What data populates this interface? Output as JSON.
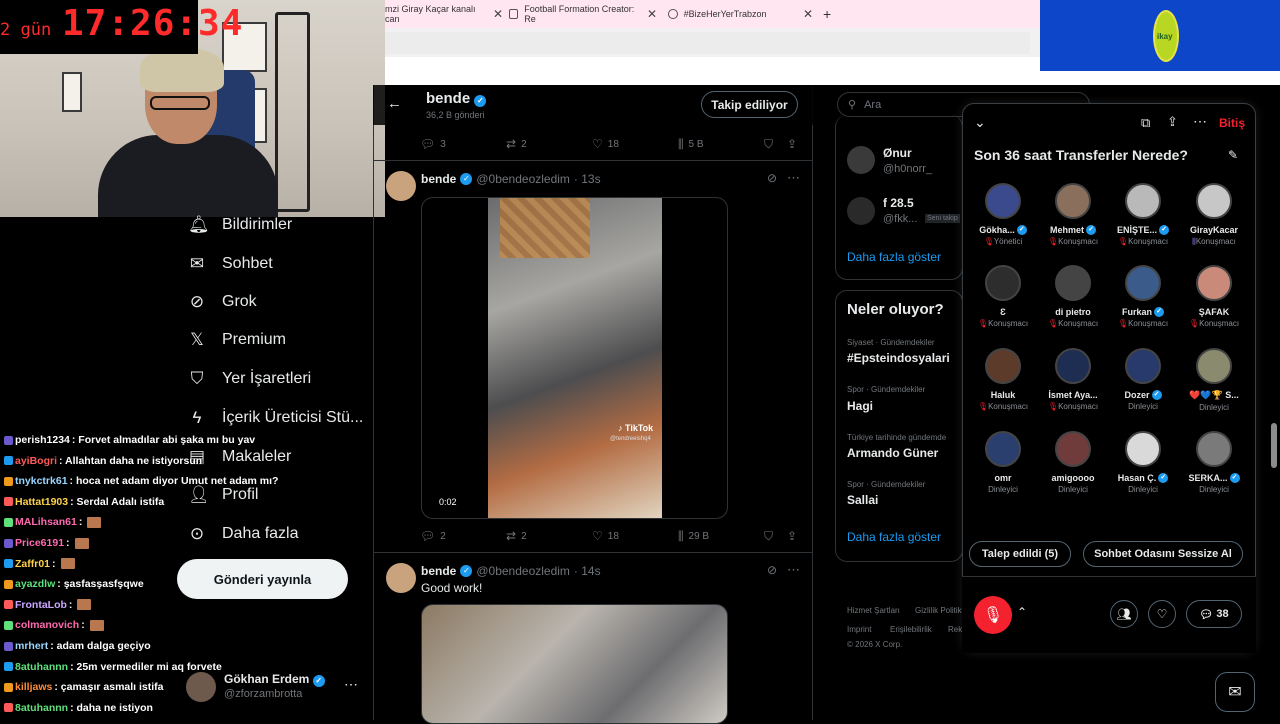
{
  "stream": {
    "timer_days": "2 gün",
    "timer_clock": "17:26:34"
  },
  "browser": {
    "tabs": [
      {
        "label": "mzi Giray Kaçar kanalı can"
      },
      {
        "label": "Football Formation Creator: Re"
      },
      {
        "label": "#BizeHerYerTrabzon"
      }
    ],
    "new_tab": "+",
    "brand_logo_text": "ikay"
  },
  "nav": {
    "items": [
      {
        "label": "Bildirimler",
        "icon": "bell-icon"
      },
      {
        "label": "Sohbet",
        "icon": "mail-icon"
      },
      {
        "label": "Grok",
        "icon": "grok-icon"
      },
      {
        "label": "Premium",
        "icon": "x-logo-icon"
      },
      {
        "label": "Yer İşaretleri",
        "icon": "bookmark-icon"
      },
      {
        "label": "İçerik Üreticisi Stü...",
        "icon": "lightning-icon"
      },
      {
        "label": "Makaleler",
        "icon": "article-icon"
      },
      {
        "label": "Profil",
        "icon": "person-icon"
      },
      {
        "label": "Daha fazla",
        "icon": "more-circle-icon"
      }
    ],
    "post_button": "Gönderi yayınla",
    "profile": {
      "name": "Gökhan Erdem",
      "handle": "@zforzambrotta",
      "more": "⋯"
    }
  },
  "chat": [
    {
      "user": "perish1234",
      "msg": ": Forvet almadılar abi şaka mı bu yav",
      "color": "#ffffff"
    },
    {
      "user": "ayiBogri",
      "msg": ": Allahtan daha ne istiyorsun",
      "color": "#ff5a5a"
    },
    {
      "user": "tnykctrk61",
      "msg": ": hoca net adam diyor Umut net adam mı?",
      "color": "#9ad7ff"
    },
    {
      "user": "Hattat1903",
      "msg": ": Serdal Adalı istifa",
      "color": "#ffd24a"
    },
    {
      "user": "MALihsan61",
      "msg": ":",
      "color": "#ff6ab0",
      "emote": true
    },
    {
      "user": "Price6191",
      "msg": ":",
      "color": "#ff6ab0",
      "emote": true
    },
    {
      "user": "Zaffr01",
      "msg": ":",
      "color": "#ffd24a",
      "emote": true
    },
    {
      "user": "ayazdlw",
      "msg": ": şasfasşasfşqwe",
      "color": "#5ee07a"
    },
    {
      "user": "FrontaLob",
      "msg": ":",
      "color": "#c9a7ff",
      "emote": true
    },
    {
      "user": "colmanovich",
      "msg": ":",
      "color": "#ff6ab0",
      "emote": true
    },
    {
      "user": "mrhert",
      "msg": ": adam dalga geçiyo",
      "color": "#9ad7ff"
    },
    {
      "user": "8atuhannn",
      "msg": ": 25m vermediler mi aq forvete",
      "color": "#5ee07a"
    },
    {
      "user": "killjaws",
      "msg": ": çamaşır asmalı istifa",
      "color": "#ff8c3a"
    },
    {
      "user": "8atuhannn",
      "msg": ": daha ne istiyon",
      "color": "#5ee07a"
    }
  ],
  "timeline": {
    "header_name": "bende",
    "header_count": "36,2 B gönderi",
    "follow_button": "Takip ediliyor",
    "top_actions": {
      "replies": "3",
      "reposts": "2",
      "likes": "18",
      "views": "5 B"
    },
    "tweets": [
      {
        "name": "bende",
        "handle": "@0bendeozledim",
        "time": "· 13s",
        "video_time": "0:02",
        "tiktok": "TikTok",
        "tiktok_user": "@tendreeishq4",
        "replies": "2",
        "reposts": "2",
        "likes": "18",
        "views": "29 B"
      },
      {
        "name": "bende",
        "handle": "@0bendeozledim",
        "time": "· 14s",
        "text": "Good work!"
      }
    ]
  },
  "sidebar": {
    "search_placeholder": "Ara",
    "who_to_follow": [
      {
        "name": "Ønur",
        "handle": "@h0norr_"
      },
      {
        "name": "f 28.5",
        "handle": "@fkk...",
        "badge": "Seni takip"
      }
    ],
    "show_more": "Daha fazla göster",
    "trends_title": "Neler oluyor?",
    "trends": [
      {
        "meta": "Siyaset · Gündemdekiler",
        "name": "#Epsteindosyalari"
      },
      {
        "meta": "Spor · Gündemdekiler",
        "name": "Hagi"
      },
      {
        "meta": "Türkiye tarihinde gündemde",
        "name": "Armando Güner"
      },
      {
        "meta": "Spor · Gündemdekiler",
        "name": "Sallai"
      }
    ],
    "trends_more": "Daha fazla göster",
    "footer": [
      "Hizmet Şartları",
      "Gizlilik Politik",
      "Imprint",
      "Erişilebilirlik",
      "Rek",
      "© 2026 X Corp."
    ]
  },
  "spaces": {
    "end_label": "Bitiş",
    "title": "Son 36 saat Transferler Nerede?",
    "speakers": [
      {
        "name": "Gökha...",
        "role": "Yönetici",
        "verified": true,
        "mic": true
      },
      {
        "name": "Mehmet",
        "role": "Konuşmacı",
        "verified": true,
        "mic": true
      },
      {
        "name": "ENİŞTE...",
        "role": "Konuşmacı",
        "verified": true,
        "mic": true
      },
      {
        "name": "GirayKacar",
        "role": "Konuşmacı",
        "verified": false,
        "mic": false,
        "speaking": true
      },
      {
        "name": "Ɛ",
        "role": "Konuşmacı",
        "verified": false,
        "mic": true
      },
      {
        "name": "di pietro",
        "role": "Konuşmacı",
        "verified": false,
        "mic": true
      },
      {
        "name": "Furkan",
        "role": "Konuşmacı",
        "verified": true,
        "mic": true
      },
      {
        "name": "ŞAFAK",
        "role": "Konuşmacı",
        "verified": false,
        "mic": true
      },
      {
        "name": "Haluk",
        "role": "Konuşmacı",
        "verified": false,
        "mic": true
      },
      {
        "name": "İsmet Aya...",
        "role": "Konuşmacı",
        "verified": false,
        "mic": true
      },
      {
        "name": "Dozer",
        "role": "Dinleyici",
        "verified": true,
        "mic": false
      },
      {
        "name": "❤️💙🏆 S...",
        "role": "Dinleyici",
        "verified": false,
        "mic": false
      },
      {
        "name": "omr",
        "role": "Dinleyici",
        "verified": false,
        "mic": false
      },
      {
        "name": "amigoooo",
        "role": "Dinleyici",
        "verified": false,
        "mic": false
      },
      {
        "name": "Hasan Ç.",
        "role": "Dinleyici",
        "verified": true,
        "mic": false
      },
      {
        "name": "SERKA...",
        "role": "Dinleyici",
        "verified": true,
        "mic": false
      }
    ],
    "request_button": "Talep edildi (5)",
    "mute_room_button": "Sohbet Odasını Sessize Al",
    "comment_count": "38"
  }
}
